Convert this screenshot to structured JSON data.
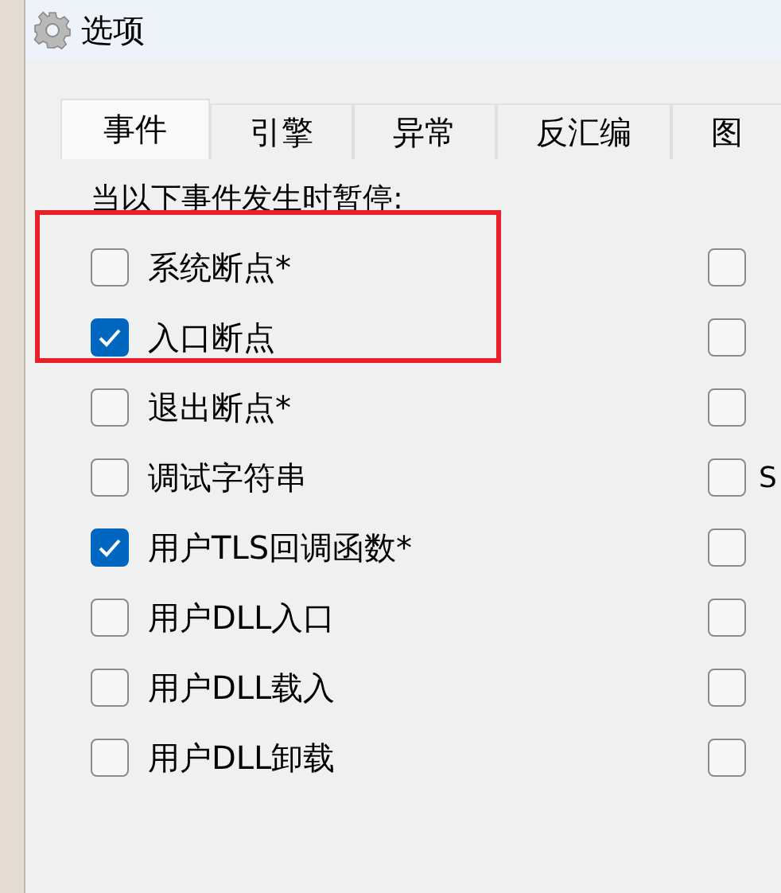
{
  "window": {
    "title": "选项"
  },
  "tabs": [
    {
      "label": "事件",
      "selected": true
    },
    {
      "label": "引擎",
      "selected": false
    },
    {
      "label": "异常",
      "selected": false
    },
    {
      "label": "反汇编",
      "selected": false
    },
    {
      "label": "图",
      "selected": false
    }
  ],
  "pane": {
    "heading": "当以下事件发生时暂停:",
    "left_options": [
      {
        "label": "系统断点*",
        "checked": false
      },
      {
        "label": "入口断点",
        "checked": true
      },
      {
        "label": "退出断点*",
        "checked": false
      },
      {
        "label": "调试字符串",
        "checked": false
      },
      {
        "label": "用户TLS回调函数*",
        "checked": true
      },
      {
        "label": "用户DLL入口",
        "checked": false
      },
      {
        "label": "用户DLL载入",
        "checked": false
      },
      {
        "label": "用户DLL卸载",
        "checked": false
      }
    ],
    "right_options": [
      {
        "checked": false
      },
      {
        "checked": false
      },
      {
        "checked": false
      },
      {
        "label": "S",
        "checked": false
      },
      {
        "checked": false
      },
      {
        "checked": false
      },
      {
        "checked": false
      },
      {
        "checked": false
      }
    ]
  }
}
